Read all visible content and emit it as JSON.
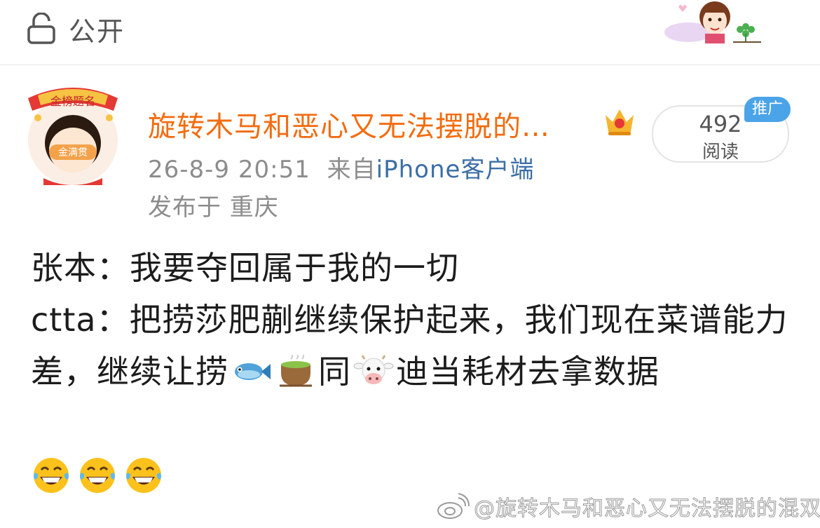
{
  "header": {
    "visibility_label": "公开"
  },
  "post": {
    "username": "旋转木马和恶心又无法摆脱的…",
    "timestamp": "26-8-9 20:51",
    "source_prefix": "来自",
    "source": "iPhone客户端",
    "location": "发布于 重庆",
    "reads_count": "492",
    "reads_label": "阅读",
    "promo_badge": "推广"
  },
  "content": {
    "line1": "张本：我要夺回属于我的一切",
    "line2": "ctta：把捞莎肥蒯继续保护起来，我们现在菜谱能力差，继续让捞",
    "line2_mid": "同",
    "line2_end": "迪当耗材去拿数据",
    "emoji_names": [
      "fish-emoji",
      "green-tea-emoji",
      "cow-face-emoji",
      "laughing-tears-emoji"
    ]
  },
  "watermark": {
    "text": "@旋转木马和恶心又无法摆脱的混双"
  },
  "colors": {
    "username": "#f26c10",
    "meta": "#8c8c8c",
    "source_link": "#3b6ea5",
    "promo": "#4ba3e8"
  }
}
